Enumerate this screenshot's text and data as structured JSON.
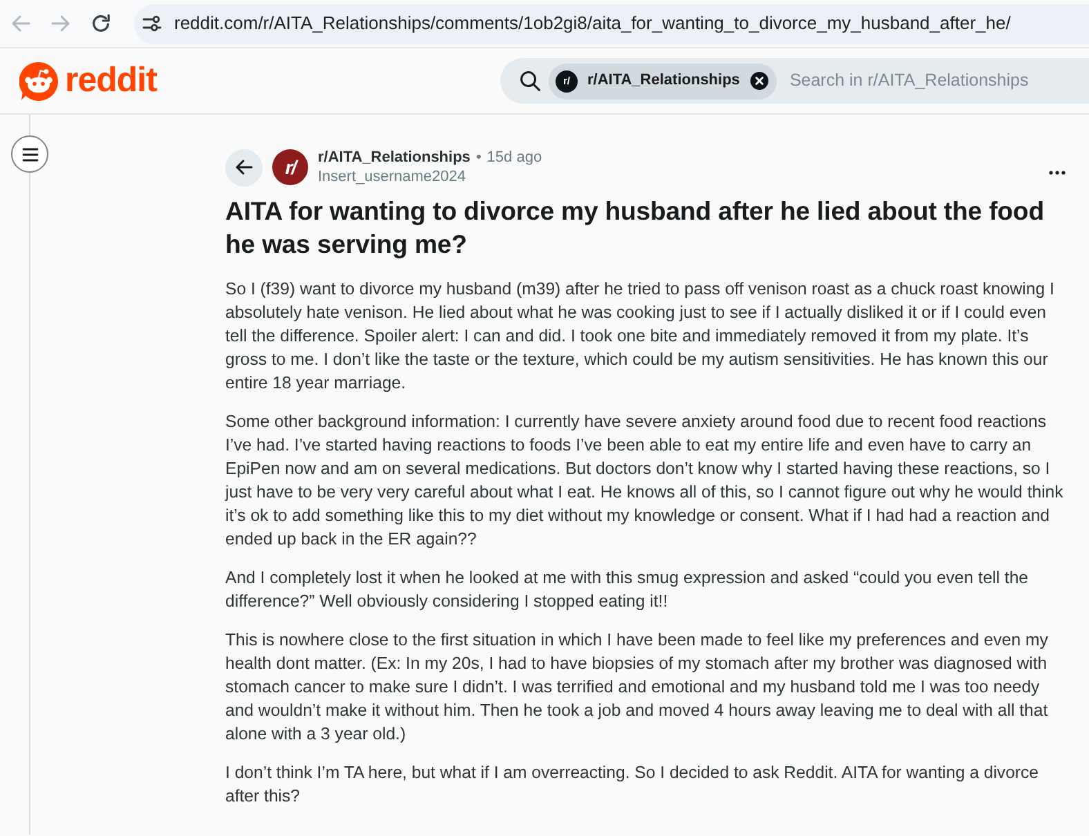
{
  "browser": {
    "nav_buttons": [
      {
        "kind": "back",
        "disabled": true
      },
      {
        "kind": "forward",
        "disabled": true
      },
      {
        "kind": "reload",
        "disabled": false
      }
    ],
    "url": "reddit.com/r/AITA_Relationships/comments/1ob2gi8/aita_for_wanting_to_divorce_my_husband_after_he/"
  },
  "header": {
    "logo_text": "reddit",
    "search": {
      "community_chip": {
        "icon_text": "r/",
        "label": "r/AITA_Relationships"
      },
      "placeholder": "Search in r/AITA_Relationships"
    }
  },
  "post": {
    "community": {
      "icon_text": "r/",
      "name": "r/AITA_Relationships"
    },
    "separator": "•",
    "time": "15d ago",
    "author": "Insert_username2024",
    "title": "AITA for wanting to divorce my husband after he lied about the food he was serving me?",
    "body": [
      "So I (f39) want to divorce my husband (m39) after he tried to pass off venison roast as a chuck roast knowing I absolutely hate venison. He lied about what he was cooking just to see if I actually disliked it or if I could even tell the difference. Spoiler alert: I can and did. I took one bite and immediately removed it from my plate. It’s gross to me. I don’t like the taste or the texture, which could be my autism sensitivities. He has known this our entire 18 year marriage.",
      "Some other background information: I currently have severe anxiety around food due to recent food reactions I’ve had. I’ve started having reactions to foods I’ve been able to eat my entire life and even have to carry an EpiPen now and am on several medications. But doctors don’t know why I started having these reactions, so I just have to be very very careful about what I eat. He knows all of this, so I cannot figure out why he would think it’s ok to add something like this to my diet without my knowledge or consent. What if I had had a reaction and ended up back in the ER again??",
      "And I completely lost it when he looked at me with this smug expression and asked “could you even tell the difference?” Well obviously considering I stopped eating it!!",
      "This is nowhere close to the first situation in which I have been made to feel like my preferences and even my health dont matter. (Ex: In my 20s, I had to have biopsies of my stomach after my brother was diagnosed with stomach cancer to make sure I didn’t. I was terrified and emotional and my husband told me I was too needy and wouldn’t make it without him. Then he took a job and moved 4 hours away leaving me to deal with all that alone with a 3 year old.)",
      "I don’t think I’m TA here, but what if I am overreacting. So I decided to ask Reddit. AITA for wanting a divorce after this?"
    ]
  }
}
